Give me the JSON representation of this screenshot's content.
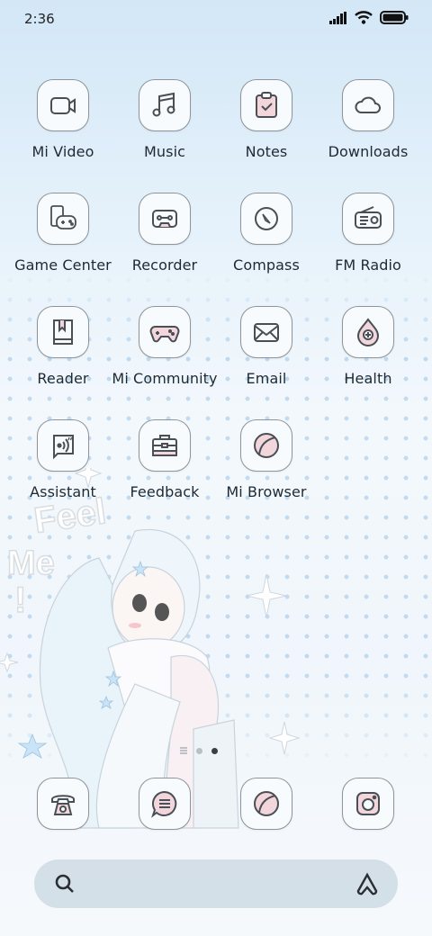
{
  "status_bar": {
    "time": "2:36",
    "icons": [
      "signal-icon",
      "wifi-icon",
      "battery-icon"
    ]
  },
  "apps": [
    {
      "label": "Mi Video",
      "icon": "video-camera-icon"
    },
    {
      "label": "Music",
      "icon": "music-note-icon"
    },
    {
      "label": "Notes",
      "icon": "clipboard-check-icon"
    },
    {
      "label": "Downloads",
      "icon": "cloud-icon"
    },
    {
      "label": "Game Center",
      "icon": "gamepad-phone-icon"
    },
    {
      "label": "Recorder",
      "icon": "recorder-icon"
    },
    {
      "label": "Compass",
      "icon": "compass-icon"
    },
    {
      "label": "FM Radio",
      "icon": "radio-icon"
    },
    {
      "label": "Reader",
      "icon": "book-icon"
    },
    {
      "label": "Mi Community",
      "icon": "gamepad-icon"
    },
    {
      "label": "Email",
      "icon": "envelope-icon"
    },
    {
      "label": "Health",
      "icon": "health-plus-icon"
    },
    {
      "label": "Assistant",
      "icon": "assistant-voice-icon"
    },
    {
      "label": "Feedback",
      "icon": "toolbox-icon"
    },
    {
      "label": "Mi Browser",
      "icon": "browser-icon"
    }
  ],
  "pager": {
    "pages": 2,
    "active": 2
  },
  "dock": [
    {
      "icon": "phone-icon"
    },
    {
      "icon": "message-icon"
    },
    {
      "icon": "browser-icon"
    },
    {
      "icon": "camera-icon"
    }
  ],
  "search": {
    "left_icon": "search-icon",
    "right_icon": "assistant-logo-icon"
  },
  "colors": {
    "icon_stroke": "#4a4f55",
    "icon_pink": "#f2d6dc",
    "icon_bg": "#f7fbfd"
  }
}
